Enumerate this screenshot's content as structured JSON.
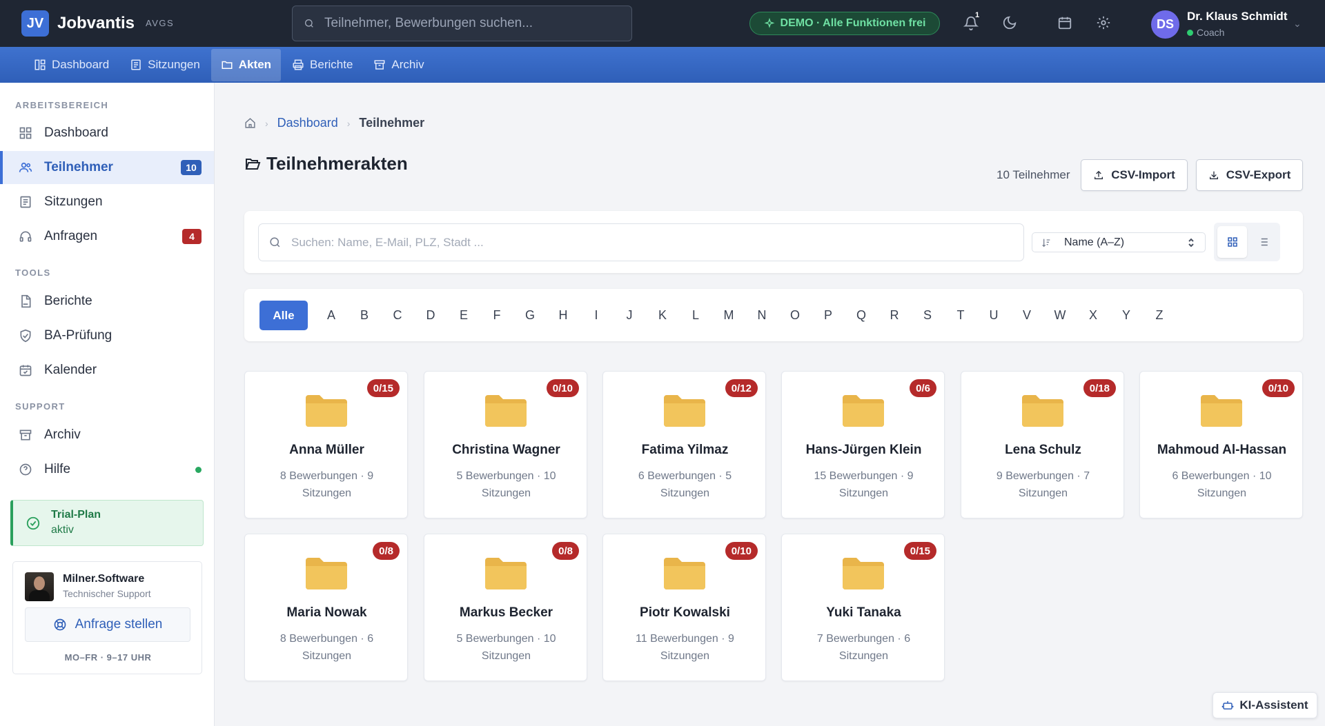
{
  "header": {
    "logo": "JV",
    "brand": "Jobvantis",
    "brand_sub": "AVGS",
    "search_placeholder": "Teilnehmer, Bewerbungen suchen...",
    "demo_badge": "DEMO · Alle Funktionen frei",
    "notification_count": "1",
    "user": {
      "initials": "DS",
      "name": "Dr. Klaus Schmidt",
      "role": "Coach"
    }
  },
  "nav": [
    {
      "label": "Dashboard",
      "icon": "dashboard-icon",
      "active": false
    },
    {
      "label": "Sitzungen",
      "icon": "sessions-icon",
      "active": false
    },
    {
      "label": "Akten",
      "icon": "folder-icon",
      "active": true
    },
    {
      "label": "Berichte",
      "icon": "printer-icon",
      "active": false
    },
    {
      "label": "Archiv",
      "icon": "archive-icon",
      "active": false
    }
  ],
  "sidebar": {
    "section_workspace": "ARBEITSBEREICH",
    "section_tools": "TOOLS",
    "section_support": "SUPPORT",
    "items": [
      {
        "label": "Dashboard",
        "icon": "grid-icon"
      },
      {
        "label": "Teilnehmer",
        "icon": "users-icon",
        "badge": "10",
        "active": true
      },
      {
        "label": "Sitzungen",
        "icon": "list-icon"
      },
      {
        "label": "Anfragen",
        "icon": "headset-icon",
        "badge": "4"
      },
      {
        "label": "Berichte",
        "icon": "pdf-icon"
      },
      {
        "label": "BA-Prüfung",
        "icon": "shield-check-icon"
      },
      {
        "label": "Kalender",
        "icon": "calendar-check-icon"
      },
      {
        "label": "Archiv",
        "icon": "archive-icon"
      },
      {
        "label": "Hilfe",
        "icon": "help-icon"
      }
    ],
    "trial": {
      "title": "Trial-Plan",
      "status": "aktiv"
    },
    "support": {
      "name": "Milner.Software",
      "role": "Technischer Support",
      "button": "Anfrage stellen",
      "hours": "MO–FR · 9–17 UHR"
    }
  },
  "colors": {
    "accent": "#3d6fd6",
    "badge_blue": "#2f5fb8",
    "badge_red": "#b52a2a",
    "folder": "#f2c55c",
    "success": "#2aa05c"
  },
  "breadcrumb": {
    "parent": "Dashboard",
    "current": "Teilnehmer"
  },
  "page": {
    "title": "Teilnehmerakten",
    "count": "10 Teilnehmer",
    "import_label": "CSV-Import",
    "export_label": "CSV-Export",
    "search_placeholder": "Suchen: Name, E-Mail, PLZ, Stadt ...",
    "sort_label": "Name (A–Z)"
  },
  "alphabet": {
    "all": "Alle",
    "letters": [
      "A",
      "B",
      "C",
      "D",
      "E",
      "F",
      "G",
      "H",
      "I",
      "J",
      "K",
      "L",
      "M",
      "N",
      "O",
      "P",
      "Q",
      "R",
      "S",
      "T",
      "U",
      "V",
      "W",
      "X",
      "Y",
      "Z"
    ]
  },
  "participants": [
    {
      "name": "Anna Müller",
      "badge": "0/15",
      "meta": "8 Bewerbungen · 9 Sitzungen"
    },
    {
      "name": "Christina Wagner",
      "badge": "0/10",
      "meta": "5 Bewerbungen · 10 Sitzungen"
    },
    {
      "name": "Fatima Yilmaz",
      "badge": "0/12",
      "meta": "6 Bewerbungen · 5 Sitzungen"
    },
    {
      "name": "Hans-Jürgen Klein",
      "badge": "0/6",
      "meta": "15 Bewerbungen · 9 Sitzungen"
    },
    {
      "name": "Lena Schulz",
      "badge": "0/18",
      "meta": "9 Bewerbungen · 7 Sitzungen"
    },
    {
      "name": "Mahmoud Al-Hassan",
      "badge": "0/10",
      "meta": "6 Bewerbungen · 10 Sitzungen"
    },
    {
      "name": "Maria Nowak",
      "badge": "0/8",
      "meta": "8 Bewerbungen · 6 Sitzungen"
    },
    {
      "name": "Markus Becker",
      "badge": "0/8",
      "meta": "5 Bewerbungen · 10 Sitzungen"
    },
    {
      "name": "Piotr Kowalski",
      "badge": "0/10",
      "meta": "11 Bewerbungen · 9 Sitzungen"
    },
    {
      "name": "Yuki Tanaka",
      "badge": "0/15",
      "meta": "7 Bewerbungen · 6 Sitzungen"
    }
  ],
  "assistant": "KI-Assistent"
}
